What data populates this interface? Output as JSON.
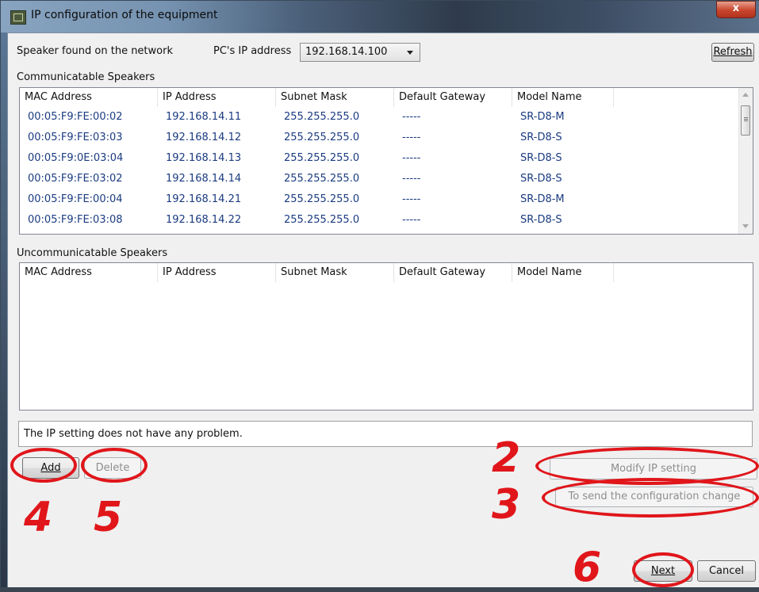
{
  "window": {
    "title": "IP configuration of the equipment",
    "close_glyph": "x"
  },
  "toolbar": {
    "found_label": "Speaker found on the network",
    "pc_ip_label": "PC's IP address",
    "pc_ip_value": "192.168.14.100",
    "refresh_label": "Refresh"
  },
  "communicatable": {
    "title": "Communicatable Speakers",
    "columns": [
      "MAC Address",
      "IP Address",
      "Subnet Mask",
      "Default Gateway",
      "Model Name"
    ],
    "rows": [
      [
        "00:05:F9:FE:00:02",
        "192.168.14.11",
        "255.255.255.0",
        "-----",
        "SR-D8-M"
      ],
      [
        "00:05:F9:FE:03:03",
        "192.168.14.12",
        "255.255.255.0",
        "-----",
        "SR-D8-S"
      ],
      [
        "00:05:F9:0E:03:04",
        "192.168.14.13",
        "255.255.255.0",
        "-----",
        "SR-D8-S"
      ],
      [
        "00:05:F9:FE:03:02",
        "192.168.14.14",
        "255.255.255.0",
        "-----",
        "SR-D8-S"
      ],
      [
        "00:05:F9:FE:00:04",
        "192.168.14.21",
        "255.255.255.0",
        "-----",
        "SR-D8-M"
      ],
      [
        "00:05:F9:FE:03:08",
        "192.168.14.22",
        "255.255.255.0",
        "-----",
        "SR-D8-S"
      ]
    ]
  },
  "uncommunicatable": {
    "title": "Uncommunicatable Speakers",
    "columns": [
      "MAC Address",
      "IP Address",
      "Subnet Mask",
      "Default Gateway",
      "Model Name"
    ]
  },
  "status_message": "The IP setting does not have any problem.",
  "buttons": {
    "add": "Add",
    "delete": "Delete",
    "modify": "Modify IP setting",
    "send": "To send the configuration change",
    "next": "Next",
    "cancel": "Cancel"
  },
  "annotations": {
    "n2": "2",
    "n3": "3",
    "n4": "4",
    "n5": "5",
    "n6": "6",
    "color": "#e0161b"
  }
}
